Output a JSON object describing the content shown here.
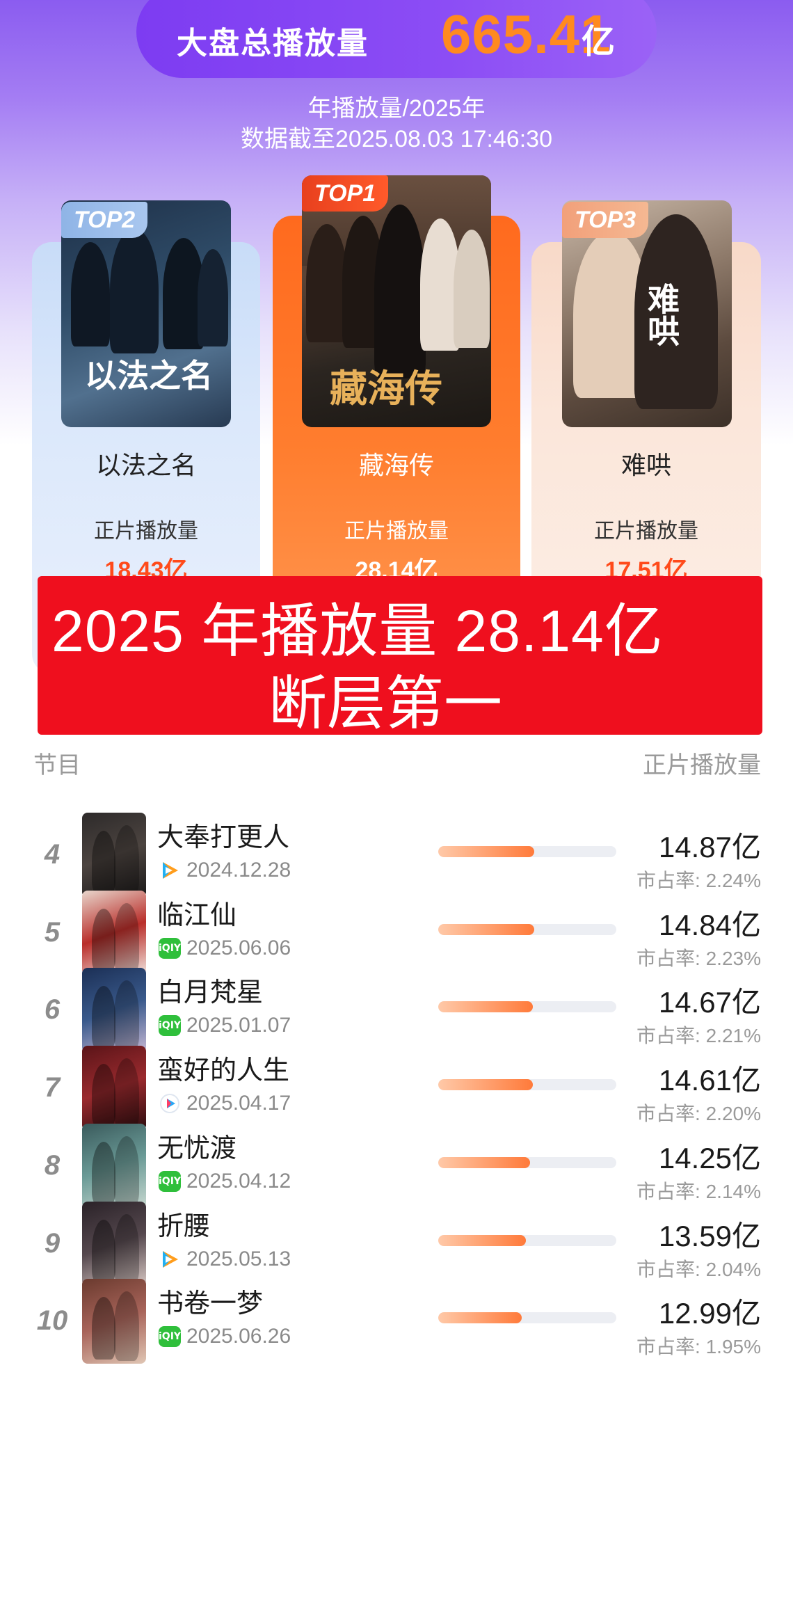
{
  "header": {
    "total_label": "大盘总播放量",
    "total_value": "665.41",
    "total_unit": "亿",
    "subtitle_1": "年播放量/2025年",
    "subtitle_2": "数据截至2025.08.03 17:46:30"
  },
  "podium": [
    {
      "badge": "TOP2",
      "name": "以法之名",
      "poster_text": "以法之名",
      "plays_label": "正片播放量",
      "plays": "18.43亿"
    },
    {
      "badge": "TOP1",
      "name": "藏海传",
      "poster_text": "藏海传",
      "plays_label": "正片播放量",
      "plays": "28.14亿"
    },
    {
      "badge": "TOP3",
      "name": "难哄",
      "poster_text": "难哄",
      "plays_label": "正片播放量",
      "plays": "17.51亿"
    }
  ],
  "banner": {
    "line1": "2025 年播放量 28.14亿",
    "line2": "断层第一"
  },
  "list_header": {
    "left": "节目",
    "right": "正片播放量"
  },
  "colors": {
    "accent_orange": "#ff6a1e",
    "banner_red": "#ef0f1e",
    "purple": "#8b5cf0",
    "iqiyi_green": "#2fbf3b"
  },
  "rows": [
    {
      "rank": "4",
      "title": "大奉打更人",
      "platform": "tencent-video-icon",
      "date": "2024.12.28",
      "value": "14.87亿",
      "share": "市占率: 2.24%",
      "share_pct": 2.24
    },
    {
      "rank": "5",
      "title": "临江仙",
      "platform": "iqiyi-icon",
      "date": "2025.06.06",
      "value": "14.84亿",
      "share": "市占率: 2.23%",
      "share_pct": 2.23
    },
    {
      "rank": "6",
      "title": "白月梵星",
      "platform": "iqiyi-icon",
      "date": "2025.01.07",
      "value": "14.67亿",
      "share": "市占率: 2.21%",
      "share_pct": 2.21
    },
    {
      "rank": "7",
      "title": "蛮好的人生",
      "platform": "youku-icon",
      "date": "2025.04.17",
      "value": "14.61亿",
      "share": "市占率: 2.20%",
      "share_pct": 2.2
    },
    {
      "rank": "8",
      "title": "无忧渡",
      "platform": "iqiyi-icon",
      "date": "2025.04.12",
      "value": "14.25亿",
      "share": "市占率: 2.14%",
      "share_pct": 2.14
    },
    {
      "rank": "9",
      "title": "折腰",
      "platform": "tencent-video-icon",
      "date": "2025.05.13",
      "value": "13.59亿",
      "share": "市占率: 2.04%",
      "share_pct": 2.04
    },
    {
      "rank": "10",
      "title": "书卷一梦",
      "platform": "iqiyi-icon",
      "date": "2025.06.26",
      "value": "12.99亿",
      "share": "市占率: 1.95%",
      "share_pct": 1.95
    }
  ]
}
